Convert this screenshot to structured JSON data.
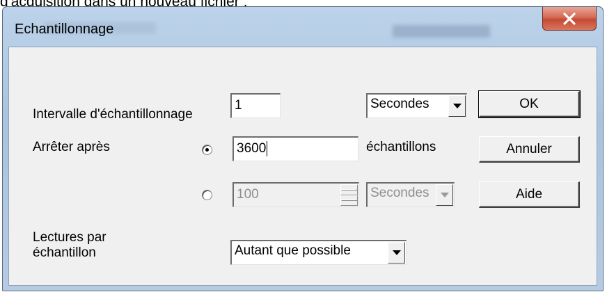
{
  "background_text": "d'acquisition dans un nouveau fichier :",
  "window": {
    "title": "Echantillonnage",
    "close_glyph": "x",
    "accent_close": "#c44a32"
  },
  "interval": {
    "label": "Intervalle d'échantillonnage",
    "value": "1",
    "unit": "Secondes"
  },
  "stop_after": {
    "label": "Arrêter après",
    "option_samples": {
      "selected": true,
      "value": "3600",
      "unit_label": "échantillons"
    },
    "option_time": {
      "selected": false,
      "value": "100",
      "unit": "Secondes",
      "enabled": false
    }
  },
  "readings": {
    "label_line1": "Lectures par",
    "label_line2": "échantillon",
    "value": "Autant que possible"
  },
  "buttons": {
    "ok": "OK",
    "cancel": "Annuler",
    "help": "Aide"
  }
}
